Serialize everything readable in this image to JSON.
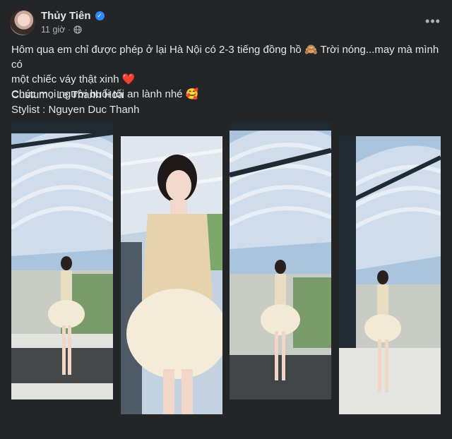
{
  "post": {
    "author": "Thủy Tiên",
    "time": "11 giờ",
    "text_line1": "Hôm qua em chỉ được phép ở lại Hà Nội có 2-3 tiếng đồng hồ 🙈 Trời nóng...may mà mình có",
    "text_line2": "một chiếc váy thật xinh ❤️",
    "text_line3": "Chúc mọi người buổi tối an lành nhé 🥰",
    "credit1": "Custum : Le Thanh Hoa",
    "credit2": "Stylist : Nguyen Duc Thanh"
  },
  "icons": {
    "verified": "verified-badge-icon",
    "privacy": "globe-icon",
    "more": "more-options-icon"
  },
  "colors": {
    "background": "#242526",
    "text": "#e4e6eb",
    "secondary": "#b0b3b8",
    "verified": "#2d88ff"
  }
}
